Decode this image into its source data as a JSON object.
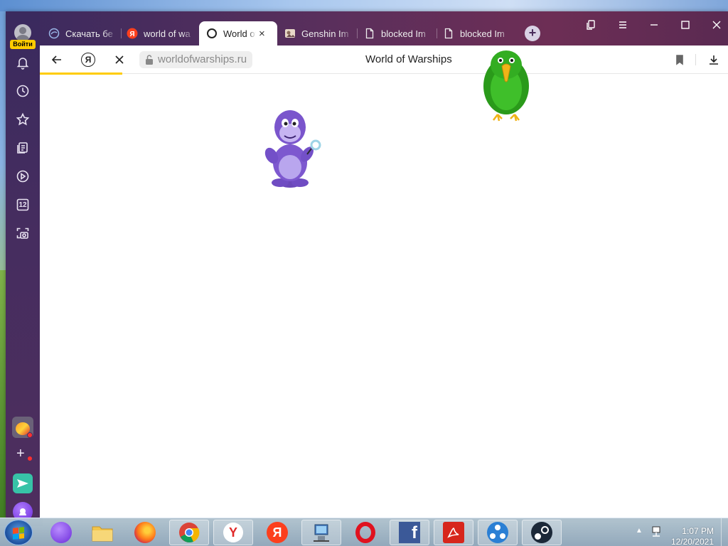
{
  "browser": {
    "profile_login": "Войти",
    "tabs": [
      {
        "label": "Скачать бе",
        "icon": "dolphin-icon"
      },
      {
        "label": "world of wa",
        "icon": "yandex-icon"
      },
      {
        "label": "World of W",
        "icon": "loading-icon",
        "active": true,
        "close": "×"
      },
      {
        "label": "Genshin Im",
        "icon": "genshin-icon"
      },
      {
        "label": "blocked Im",
        "icon": "document-icon"
      },
      {
        "label": "blocked Im",
        "icon": "document-icon"
      }
    ],
    "new_tab": "+",
    "window_buttons": [
      "bookmarks-icon",
      "menu-icon",
      "minimize-icon",
      "maximize-icon",
      "close-icon"
    ]
  },
  "toolbar": {
    "url": "worldofwarships.ru",
    "page_title": "World of Warships",
    "yandex_button": "Я",
    "load_progress_pct": 12
  },
  "sidebar": {
    "items": [
      "bell-icon",
      "history-icon",
      "star-icon",
      "collections-icon",
      "video-icon",
      "calendar-icon",
      "screenshot-icon"
    ],
    "calendar_day": "12"
  },
  "content": {
    "characters": [
      "bonzi-buddy-purple-gorilla",
      "green-parrot-peedy"
    ]
  },
  "taskbar": {
    "apps": [
      "alice-icon",
      "explorer-icon",
      "firefox-icon",
      "chrome-icon",
      "yandex-browser-icon",
      "yandex-icon",
      "network-icon",
      "opera-icon",
      "facebook-icon",
      "pdf-icon",
      "app-icon",
      "steam-icon"
    ],
    "time": "1:07 PM",
    "date": "12/20/2021"
  },
  "colors": {
    "accent_yellow": "#ffcc00",
    "frame_purple": "#452d5f"
  }
}
